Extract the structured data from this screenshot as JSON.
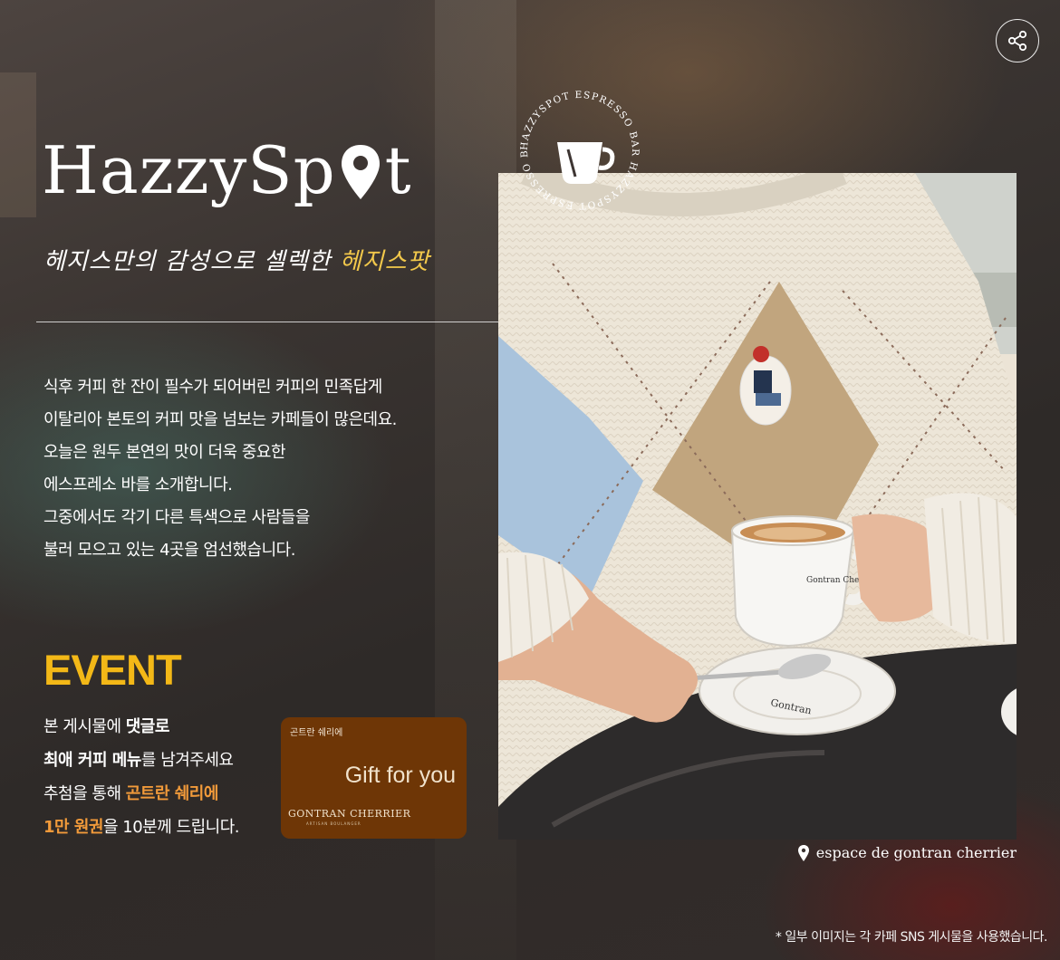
{
  "header": {
    "share_icon": "share-icon"
  },
  "logo": {
    "text_before": "HazzySp",
    "text_after": "t",
    "pin_icon": "map-pin-icon"
  },
  "tagline": {
    "main": "헤지스만의 감성으로 셀렉한 ",
    "highlight": "헤지스팟",
    "highlight_color": "#f2c84b"
  },
  "intro": {
    "lines": [
      "식후 커피 한 잔이 필수가 되어버린 커피의 민족답게",
      "이탈리아 본토의 커피 맛을 넘보는 카페들이 많은데요.",
      "오늘은 원두 본연의 맛이 더욱 중요한",
      "에스프레소 바를 소개합니다.",
      "그중에서도 각기 다른 특색으로 사람들을",
      "불러 모으고 있는 4곳을 엄선했습니다."
    ]
  },
  "event": {
    "title": "EVENT",
    "title_color": "#f3b817",
    "line1_a": "본 게시물에 ",
    "line1_b": "댓글로",
    "line2_a": "최애 커피 메뉴",
    "line2_b": "를 남겨주세요",
    "line3_a": "추첨을 통해 ",
    "line3_b": "곤트란 쉐리에",
    "line4_a": "1만 원권",
    "line4_b": "을 10분께 드립니다.",
    "accent_color": "#f19a3a"
  },
  "giftcard": {
    "small_label": "곤트란 쉐리에",
    "gift_text": "Gift for you",
    "brand": "GONTRAN CHERRIER",
    "brand_sub": "ARTISAN BOULANGER",
    "color": "#6e3606"
  },
  "stamp": {
    "ring_text": "HAZZYSPOT ESPRESSO BAR  HAZZYSPOT ESPRESSO BAR",
    "icon": "coffee-cup-icon"
  },
  "photo": {
    "cup_text": "Gontran Cherrier",
    "saucer_text": "Gontran"
  },
  "caption": {
    "icon": "location-pin-icon",
    "text": "espace de gontran cherrier"
  },
  "footnote": "* 일부 이미지는 각 카페 SNS 게시물을 사용했습니다."
}
